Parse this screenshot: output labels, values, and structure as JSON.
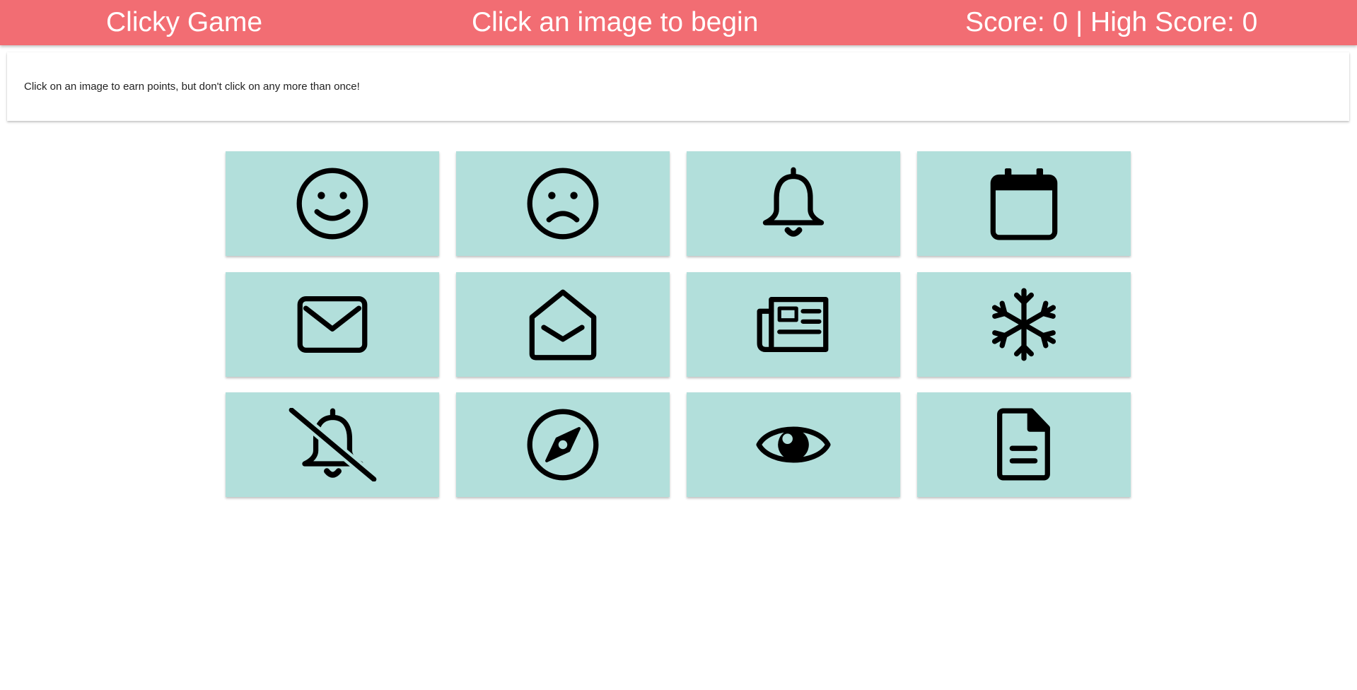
{
  "navbar": {
    "brand": "Clicky Game",
    "message": "Click an image to begin",
    "score": "Score: 0 | High Score: 0"
  },
  "instructions": {
    "text": "Click on an image to earn points, but don't click on any more than once!"
  },
  "colors": {
    "navbar_bg": "#f26d73",
    "tile_bg": "#b2dfdb",
    "icon": "#000000"
  },
  "tiles": [
    {
      "icon": "smile-icon"
    },
    {
      "icon": "frown-icon"
    },
    {
      "icon": "bell-icon"
    },
    {
      "icon": "calendar-icon"
    },
    {
      "icon": "envelope-icon"
    },
    {
      "icon": "envelope-open-icon"
    },
    {
      "icon": "newspaper-icon"
    },
    {
      "icon": "snowflake-icon"
    },
    {
      "icon": "bell-slash-icon"
    },
    {
      "icon": "compass-icon"
    },
    {
      "icon": "eye-icon"
    },
    {
      "icon": "file-alt-icon"
    }
  ]
}
